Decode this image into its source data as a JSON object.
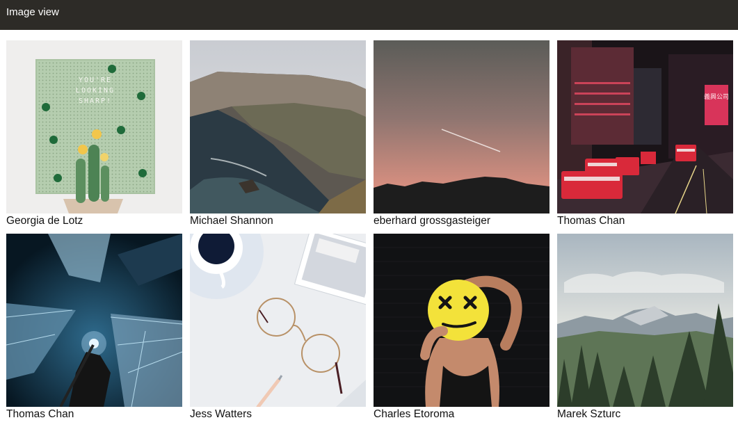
{
  "app": {
    "title": "Image view"
  },
  "photos": [
    {
      "author": "Georgia de Lotz",
      "subject": "letter-board-cactus-image",
      "board_text": "YOU'RE LOOKING SHARP!"
    },
    {
      "author": "Michael Shannon",
      "subject": "coastal-cliffs-image"
    },
    {
      "author": "eberhard grossgasteiger",
      "subject": "dusk-sky-contrail-image"
    },
    {
      "author": "Thomas Chan",
      "subject": "neon-street-buses-image",
      "sign_text": "義興公司"
    },
    {
      "author": "Thomas Chan",
      "subject": "skyscrapers-night-image"
    },
    {
      "author": "Jess Watters",
      "subject": "glasses-coffee-desk-image"
    },
    {
      "author": "Charles Etoroma",
      "subject": "smiley-face-mask-image"
    },
    {
      "author": "Marek Szturc",
      "subject": "mountain-forest-image"
    }
  ],
  "colors": {
    "appbar": "#2d2b27",
    "appbar_text": "#ffffff",
    "caption_text": "#111111"
  }
}
